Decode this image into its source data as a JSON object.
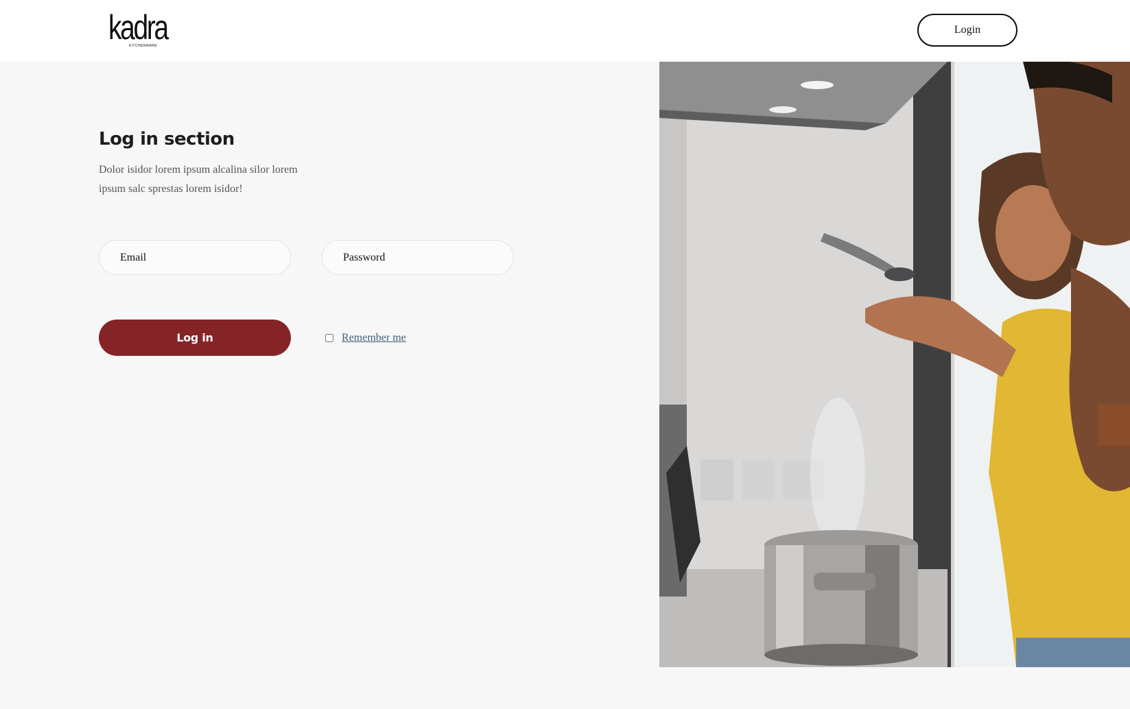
{
  "header": {
    "logo_text": "kadra",
    "logo_subtext": "KITCHENWARE",
    "login_button_label": "Login"
  },
  "login": {
    "title": "Log in section",
    "description": "Dolor isidor lorem ipsum alcalina silor lorem ipsum salc sprestas lorem isidor!",
    "email_placeholder": "Email",
    "password_placeholder": "Password",
    "submit_label": "Log in",
    "remember_label": "Remember me",
    "remember_checked": false
  },
  "hero": {
    "image_subject": "couple-cooking-kitchen-photo"
  },
  "colors": {
    "accent": "#842426",
    "link": "#3d5f78",
    "page_bg": "#f7f7f7",
    "header_bg": "#ffffff"
  }
}
